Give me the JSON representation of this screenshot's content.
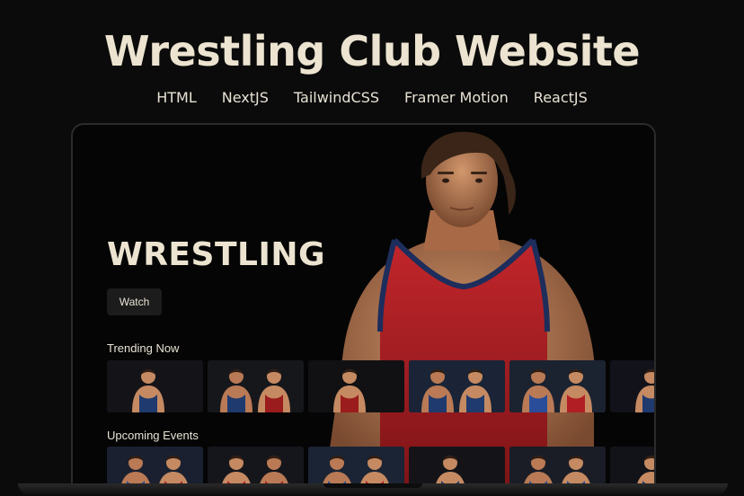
{
  "page": {
    "headline": "Wrestling Club Website",
    "tech_stack": [
      "HTML",
      "NextJS",
      "TailwindCSS",
      "Framer Motion",
      "ReactJS"
    ]
  },
  "site": {
    "hero_title": "WRESTLING",
    "watch_label": "Watch",
    "rows": [
      {
        "label": "Trending Now",
        "thumbs": [
          {
            "bg": "#141418",
            "figures": [
              {
                "skin": "#c58a62",
                "singlet": "#1f3a6e"
              }
            ]
          },
          {
            "bg": "#16171b",
            "figures": [
              {
                "skin": "#b97a55",
                "singlet": "#1f3a6e"
              },
              {
                "skin": "#c58a62",
                "singlet": "#9b1c1c"
              }
            ]
          },
          {
            "bg": "#111114",
            "figures": [
              {
                "skin": "#c58a62",
                "singlet": "#9b1c1c"
              }
            ]
          },
          {
            "bg": "#1a2436",
            "figures": [
              {
                "skin": "#b97a55",
                "singlet": "#1f3a6e"
              },
              {
                "skin": "#c58a62",
                "singlet": "#1f3a6e"
              }
            ]
          },
          {
            "bg": "#1b2230",
            "figures": [
              {
                "skin": "#b97a55",
                "singlet": "#2a4d9a"
              },
              {
                "skin": "#c58a62",
                "singlet": "#b11f24"
              }
            ]
          },
          {
            "bg": "#12131a",
            "figures": [
              {
                "skin": "#c58a62",
                "singlet": "#1f3a6e"
              }
            ]
          }
        ]
      },
      {
        "label": "Upcoming Events",
        "thumbs": [
          {
            "bg": "#1a2030",
            "figures": [
              {
                "skin": "#b97a55",
                "singlet": "#2a4d9a"
              },
              {
                "skin": "#c58a62",
                "singlet": "#b11f24"
              }
            ]
          },
          {
            "bg": "#15161b",
            "figures": [
              {
                "skin": "#c58a62",
                "singlet": "#b11f24"
              },
              {
                "skin": "#b97a55",
                "singlet": "#b11f24"
              }
            ]
          },
          {
            "bg": "#1b2434",
            "figures": [
              {
                "skin": "#b97a55",
                "singlet": "#2a4d9a"
              },
              {
                "skin": "#c58a62",
                "singlet": "#b11f24"
              }
            ]
          },
          {
            "bg": "#141418",
            "figures": [
              {
                "skin": "#c58a62",
                "singlet": "#1f3a6e"
              }
            ]
          },
          {
            "bg": "#1a1d26",
            "figures": [
              {
                "skin": "#b97a55",
                "singlet": "#2a4d9a"
              },
              {
                "skin": "#c58a62",
                "singlet": "#2a4d9a"
              }
            ]
          },
          {
            "bg": "#121318",
            "figures": [
              {
                "skin": "#c58a62",
                "singlet": "#1f3a6e"
              }
            ]
          }
        ]
      }
    ]
  },
  "colors": {
    "background": "#0b0b0b",
    "text": "#ece4d0",
    "singlet_red": "#b11f24",
    "singlet_trim": "#1d2d5c"
  }
}
